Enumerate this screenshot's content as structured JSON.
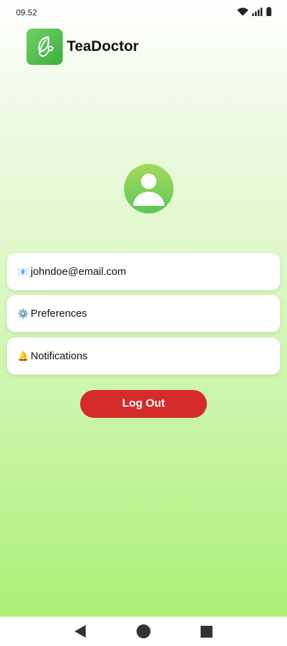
{
  "status_bar": {
    "time": "09.52"
  },
  "app": {
    "name": "TeaDoctor"
  },
  "profile": {
    "email_emoji": "📧",
    "email": "johndoe@email.com",
    "preferences_emoji": "⚙️",
    "preferences_label": "Preferences",
    "notifications_emoji": "🔔",
    "notifications_label": "Notifications"
  },
  "actions": {
    "logout_label": "Log Out"
  },
  "colors": {
    "logout": "#d62b2b",
    "logo_green": "#4cbf48",
    "avatar_green": "#6fcd5a"
  },
  "icons": {
    "wifi": "wifi-icon",
    "signal": "signal-icon",
    "battery": "battery-icon",
    "back": "back-triangle-icon",
    "home": "home-circle-icon",
    "recents": "recents-square-icon"
  }
}
